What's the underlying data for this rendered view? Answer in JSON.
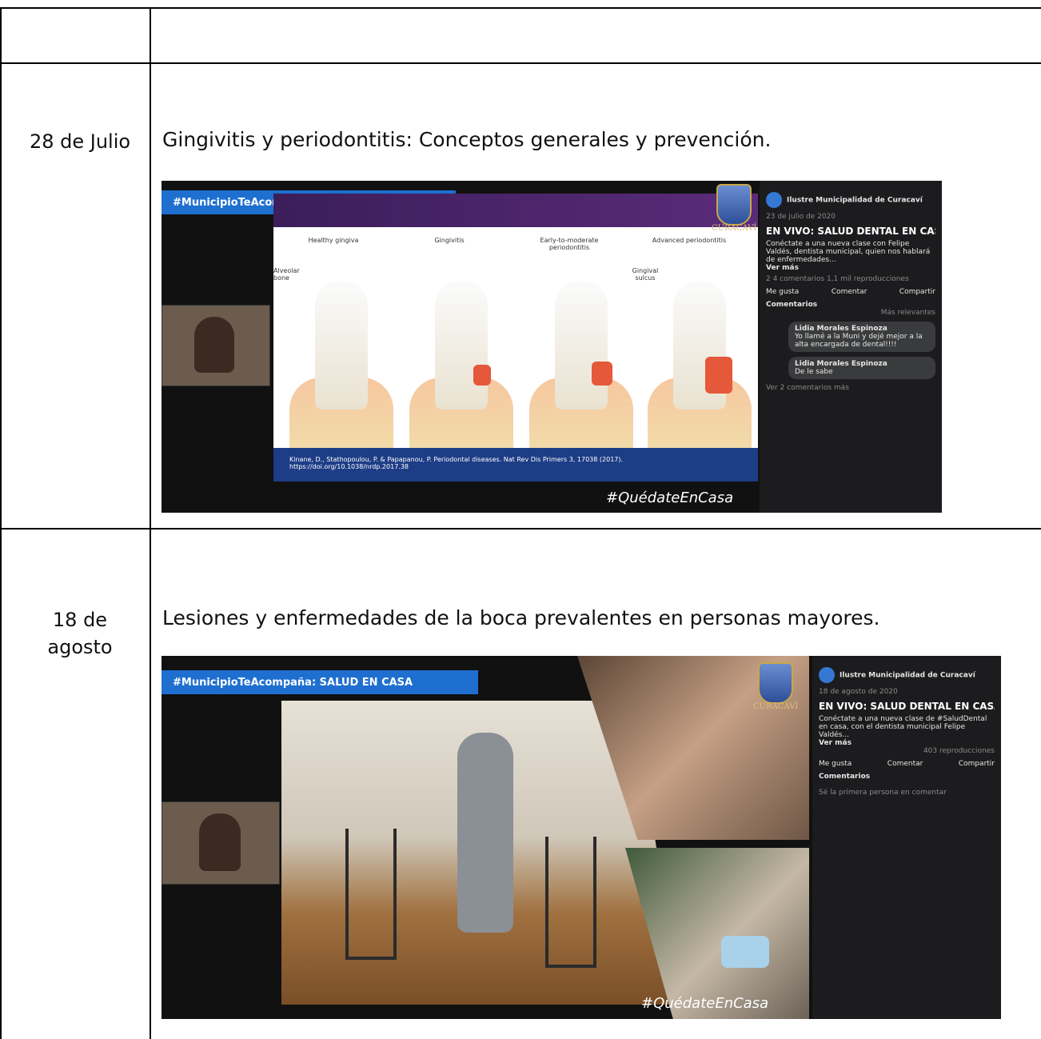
{
  "rows": [
    {
      "date": "",
      "topic": ""
    },
    {
      "date": "28 de Julio",
      "topic": "Gingivitis y periodontitis: Conceptos generales y prevención.",
      "screenshot": {
        "banner": "#MunicipioTeAcompaña: SALUD EN CASA",
        "crest_label": "CURACAVÍ",
        "hashtag": "#QuédateEnCasa",
        "slide_labels": [
          "Healthy gingiva",
          "Gingivitis",
          "Early-to-moderate periodontitis",
          "Advanced periodontitis"
        ],
        "slide_side_labels": [
          "Alveolar bone",
          "Gingival sulcus"
        ],
        "slide_reference": "Kinane, D., Stathopoulou, P. & Papapanou, P. Periodontal diseases. Nat Rev Dis Primers 3, 17038 (2017). https://doi.org/10.1038/nrdp.2017.38",
        "sidebar": {
          "page_name": "Ilustre Municipalidad de Curacaví",
          "meta": "23 de julio de 2020",
          "post_title": "EN VIVO: SALUD DENTAL EN CASA.",
          "post_text": "Conéctate a una nueva clase con Felipe Valdés, dentista municipal, quien nos hablará de enfermedades...",
          "see_more": "Ver más",
          "stats": "2 4 comentarios  1,1 mil reproducciones",
          "actions": [
            "Me gusta",
            "Comentar",
            "Compartir"
          ],
          "comments_label": "Comentarios",
          "sort_label": "Más relevantes",
          "comments": [
            {
              "author": "Lidia Morales Espinoza",
              "text": "Yo llamé a la Muni y dejé mejor a la alta encargada de dental!!!!"
            },
            {
              "author": "Lidia Morales Espinoza",
              "text": "De le sabe"
            }
          ],
          "more_comments": "Ver 2 comentarios más"
        }
      }
    },
    {
      "date": "18 de agosto",
      "topic": "Lesiones y enfermedades de la boca prevalentes en personas mayores.",
      "screenshot": {
        "banner": "#MunicipioTeAcompaña: SALUD EN CASA",
        "crest_label": "CURACAVÍ",
        "hashtag": "#QuédateEnCasa",
        "sidebar": {
          "page_name": "Ilustre Municipalidad de Curacaví",
          "meta": "18 de agosto de 2020",
          "post_title": "EN VIVO: SALUD DENTAL EN CASA.",
          "post_text": "Conéctate a una nueva clase de #SaludDental en casa, con el dentista municipal Felipe Valdés...",
          "see_more": "Ver más",
          "stats": "403 reproducciones",
          "actions": [
            "Me gusta",
            "Comentar",
            "Compartir"
          ],
          "comments_label": "Comentarios",
          "first_comment_prompt": "Sé la primera persona en comentar"
        }
      }
    }
  ],
  "colors": {
    "banner": "#1e6fd0",
    "sidebar_bg": "#1c1c1e",
    "inflamed_gum": "#e5583a",
    "slide_footer": "#1d3d86"
  }
}
